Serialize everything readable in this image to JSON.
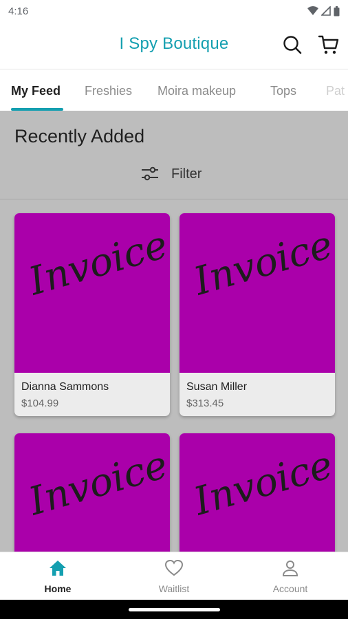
{
  "status": {
    "time": "4:16"
  },
  "app": {
    "title": "I Spy Boutique"
  },
  "tabs": [
    {
      "label": "My Feed"
    },
    {
      "label": "Freshies"
    },
    {
      "label": "Moira makeup"
    },
    {
      "label": "Tops"
    },
    {
      "label": "Pat"
    }
  ],
  "section": {
    "title": "Recently Added",
    "filter_label": "Filter"
  },
  "products": [
    {
      "image_text": "Invoice",
      "name": "Dianna Sammons",
      "price": "$104.99"
    },
    {
      "image_text": "Invoice",
      "name": "Susan Miller",
      "price": "$313.45"
    },
    {
      "image_text": "Invoice",
      "name": "",
      "price": ""
    },
    {
      "image_text": "Invoice",
      "name": "",
      "price": ""
    }
  ],
  "nav": [
    {
      "label": "Home",
      "icon": "home-icon"
    },
    {
      "label": "Waitlist",
      "icon": "heart-icon"
    },
    {
      "label": "Account",
      "icon": "account-icon"
    }
  ],
  "colors": {
    "accent": "#149fb0",
    "product_image": "#aa00aa"
  }
}
